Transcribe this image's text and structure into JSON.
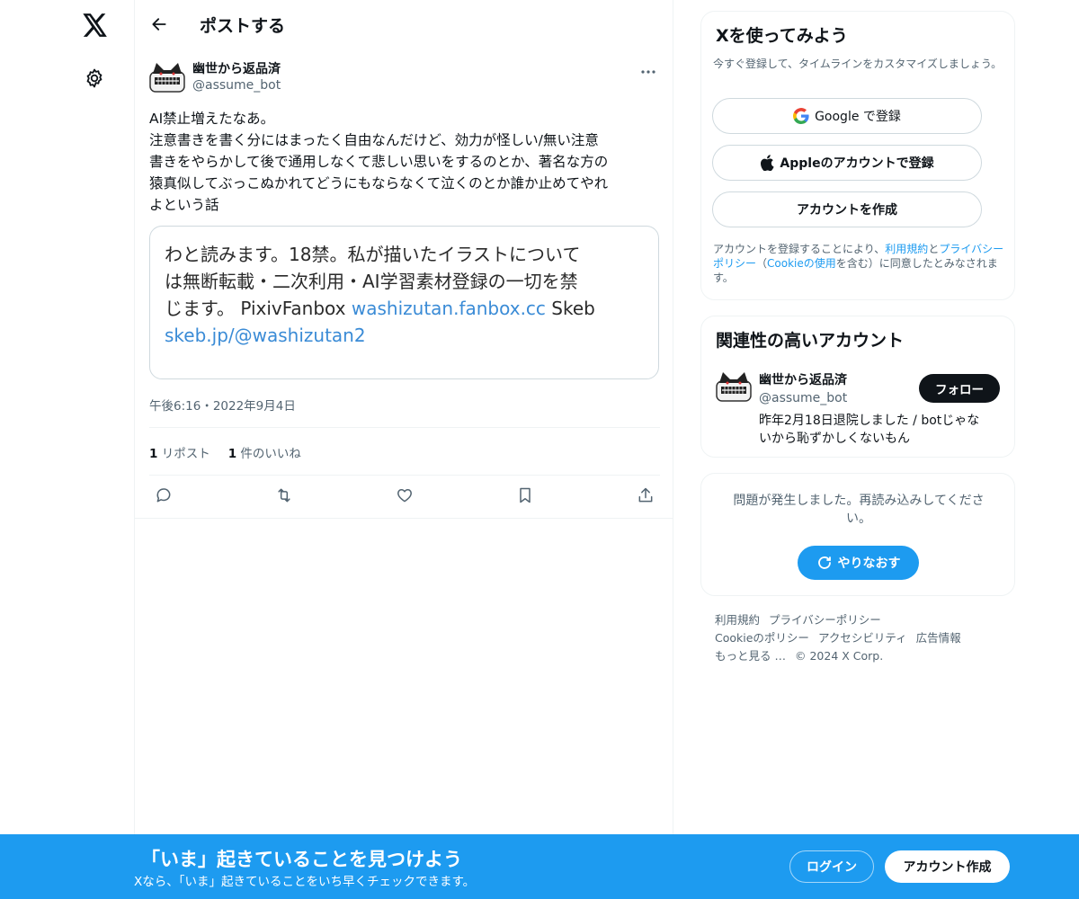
{
  "header": {
    "title": "ポストする"
  },
  "post": {
    "author_name": "幽世から返品済",
    "author_handle": "@assume_bot",
    "text_lines": [
      "AI禁止増えたなあ。",
      "注意書きを書く分にはまったく自由なんだけど、効力が怪しい/無い注意",
      "書きをやらかして後で通用しなくて悲しい思いをするのとか、著名な方の",
      "猿真似してぶっこぬかれてどうにもならなくて泣くのとか誰か止めてやれ",
      "よという話"
    ],
    "embed": {
      "line1": "わと読みます。18禁。私が描いたイラストについて",
      "line2": "は無断転載・二次利用・AI学習素材登録の一切を禁",
      "line3_pre": "じます。 PixivFanbox ",
      "line3_link": "washizutan.fanbox.cc",
      "line3_post": " Skeb",
      "line4_link": "skeb.jp/@washizutan2"
    },
    "timestamp": "午後6:16・2022年9月4日",
    "repost_count": "1",
    "repost_label": "リポスト",
    "like_count": "1",
    "like_label": "件のいいね"
  },
  "signup": {
    "title": "Xを使ってみよう",
    "subtitle": "今すぐ登録して、タイムラインをカスタマイズしましょう。",
    "google_label": "Google で登録",
    "apple_label": "Appleのアカウントで登録",
    "create_label": "アカウントを作成",
    "terms_pre": "アカウントを登録することにより、",
    "terms_link1": "利用規約",
    "terms_mid1": "と",
    "terms_link2": "プライバシーポリシー",
    "terms_mid2": "（",
    "terms_link3": "Cookieの使用",
    "terms_post": "を含む）に同意したとみなされます。"
  },
  "related": {
    "title": "関連性の高いアカウント",
    "name": "幽世から返品済",
    "handle": "@assume_bot",
    "follow_label": "フォロー",
    "bio_line1": "昨年2月18日退院しました / botじゃな",
    "bio_line2": "いから恥ずかしくないもん"
  },
  "error": {
    "message_line1": "問題が発生しました。再読み込みしてくださ",
    "message_line2": "い。",
    "retry_label": "やりなおす"
  },
  "footer": {
    "terms": "利用規約",
    "privacy": "プライバシーポリシー",
    "cookie": "Cookieのポリシー",
    "accessibility": "アクセシビリティ",
    "ads": "広告情報",
    "more": "もっと見る …",
    "copyright": "© 2024 X Corp."
  },
  "bottombar": {
    "title": "「いま」起きていることを見つけよう",
    "subtitle": "Xなら、「いま」起きていることをいち早くチェックできます。",
    "login_label": "ログイン",
    "create_label": "アカウント作成"
  },
  "colors": {
    "accent": "#1d9bf0",
    "text": "#0f1419",
    "muted": "#536471",
    "border": "#eff3f4"
  }
}
